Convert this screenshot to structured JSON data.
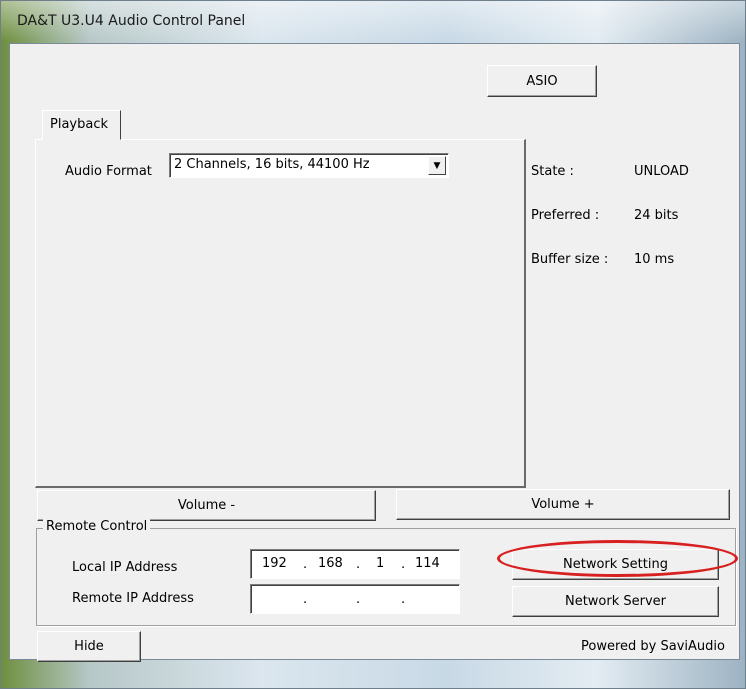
{
  "window": {
    "title": "DA&T U3.U4 Audio Control Panel"
  },
  "toolbar": {
    "asio_label": "ASIO"
  },
  "tabs": [
    {
      "label": "Playback"
    }
  ],
  "playback": {
    "audio_format_label": "Audio Format",
    "audio_format_value": "2 Channels, 16 bits, 44100 Hz"
  },
  "status": {
    "state_label": "State :",
    "state_value": "UNLOAD",
    "preferred_label": "Preferred :",
    "preferred_value": "24 bits",
    "buffer_label": "Buffer size :",
    "buffer_value": "10 ms"
  },
  "volume": {
    "down_label": "Volume -",
    "up_label": "Volume +"
  },
  "remote_control": {
    "group_label": "Remote Control",
    "local_ip_label": "Local IP Address",
    "local_ip": [
      "192",
      "168",
      "1",
      "114"
    ],
    "remote_ip_label": "Remote IP Address",
    "remote_ip": [
      "",
      "",
      "",
      ""
    ],
    "dot": ".",
    "network_setting_label": "Network Setting",
    "network_server_label": "Network Server",
    "highlight_color": "#d82020"
  },
  "footer": {
    "hide_label": "Hide",
    "powered_by": "Powered by SaviAudio"
  },
  "colors": {
    "dialog_bg": "#f0f0f0",
    "annotation": "#d82020"
  }
}
